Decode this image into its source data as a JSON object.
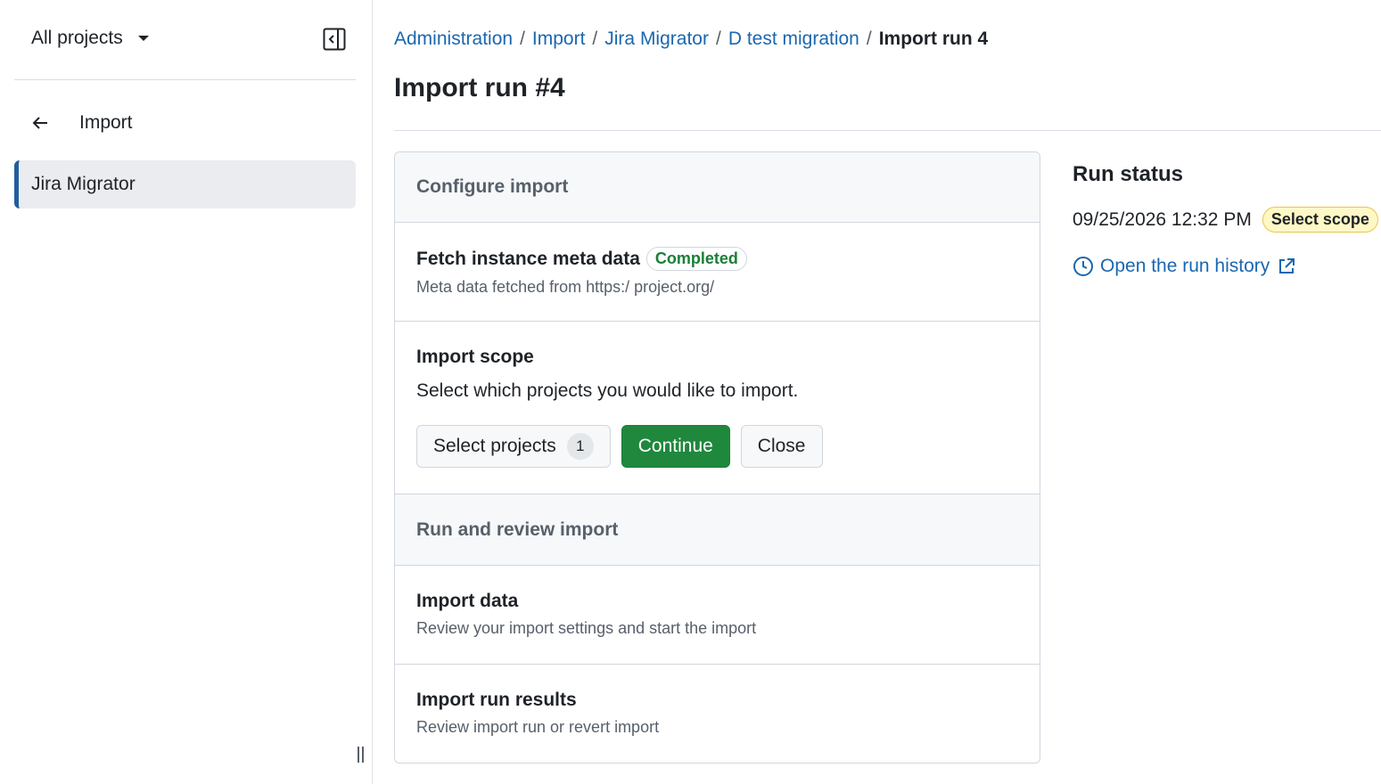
{
  "sidebar": {
    "project_selector": "All projects",
    "back_label": "Import",
    "items": [
      {
        "label": "Jira Migrator",
        "active": true
      }
    ]
  },
  "breadcrumb": [
    {
      "label": "Administration"
    },
    {
      "label": "Import"
    },
    {
      "label": "Jira Migrator"
    },
    {
      "label": "D test migration"
    },
    {
      "label": "Import run 4",
      "current": true
    }
  ],
  "page": {
    "title": "Import run #4"
  },
  "configure": {
    "heading": "Configure import",
    "fetch": {
      "title": "Fetch instance meta data",
      "status": "Completed",
      "subtitle": "Meta data fetched from https:/             project.org/"
    },
    "scope": {
      "title": "Import scope",
      "description": "Select which projects you would like to import.",
      "select_button": "Select projects",
      "select_count": "1",
      "continue_button": "Continue",
      "close_button": "Close"
    }
  },
  "review": {
    "heading": "Run and review import",
    "import_data": {
      "title": "Import data",
      "subtitle": "Review your import settings and start the import"
    },
    "results": {
      "title": "Import run results",
      "subtitle": "Review import run or revert import"
    }
  },
  "run_status": {
    "title": "Run status",
    "timestamp": "09/25/2026 12:32 PM",
    "badge": "Select scope",
    "history_link": "Open the run history"
  },
  "colors": {
    "link": "#1a67b0",
    "primary": "#1f883d",
    "success_text": "#1a7f37",
    "attention_bg": "#fff8c5",
    "sidebar_accent": "#1f5f9e"
  }
}
